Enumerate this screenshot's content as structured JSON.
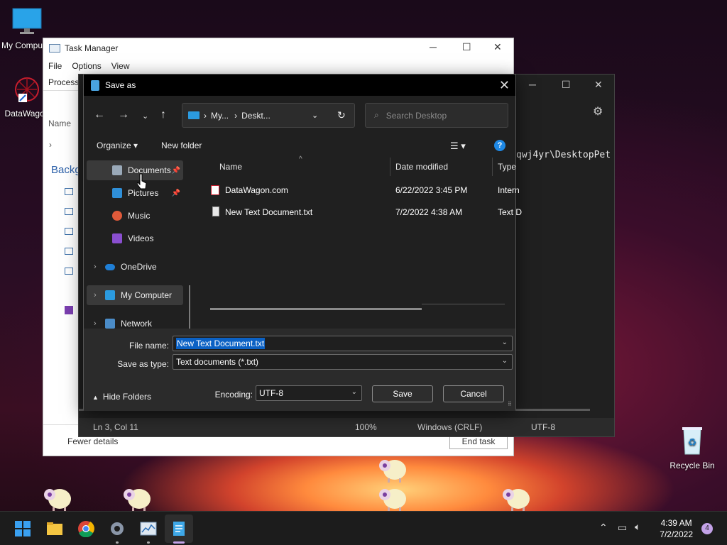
{
  "desktop": {
    "icons": [
      {
        "label": "My Computer"
      },
      {
        "label": "DataWagon"
      },
      {
        "label": "Recycle Bin"
      }
    ]
  },
  "task_manager": {
    "title": "Task Manager",
    "menu": [
      "File",
      "Options",
      "View"
    ],
    "tab_partial": "Processes",
    "col_name": "Name",
    "section": "Backg",
    "footer_left": "Fewer details",
    "footer_right": "End task"
  },
  "notepad": {
    "path_fragment": "qwj4yr\\DesktopPet",
    "status": {
      "position": "Ln 3, Col 11",
      "zoom": "100%",
      "eol": "Windows (CRLF)",
      "encoding": "UTF-8"
    }
  },
  "save_dialog": {
    "title": "Save as",
    "address": {
      "seg1": "My...",
      "seg2": "Deskt..."
    },
    "search_placeholder": "Search Desktop",
    "toolbar": {
      "organize": "Organize",
      "new_folder": "New folder",
      "help": "?"
    },
    "nav": [
      {
        "label": "Documents"
      },
      {
        "label": "Pictures"
      },
      {
        "label": "Music"
      },
      {
        "label": "Videos"
      },
      {
        "label": "OneDrive"
      },
      {
        "label": "My Computer"
      },
      {
        "label": "Network"
      }
    ],
    "columns": {
      "name": "Name",
      "date": "Date modified",
      "type": "Type"
    },
    "files": [
      {
        "name": "DataWagon.com",
        "date": "6/22/2022 3:45 PM",
        "type": "Intern"
      },
      {
        "name": "New Text Document.txt",
        "date": "7/2/2022 4:38 AM",
        "type": "Text D"
      }
    ],
    "file_name_label": "File name:",
    "file_name_value": "New Text Document.txt",
    "save_type_label": "Save as type:",
    "save_type_value": "Text documents (*.txt)",
    "hide_folders": "Hide Folders",
    "encoding_label": "Encoding:",
    "encoding_value": "UTF-8",
    "save_button": "Save",
    "cancel_button": "Cancel"
  },
  "taskbar": {
    "time": "4:39 AM",
    "date": "7/2/2022",
    "notifications": "4"
  }
}
